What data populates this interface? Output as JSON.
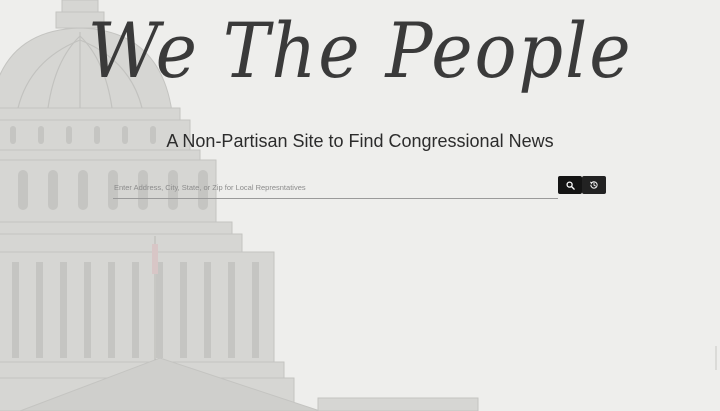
{
  "header": {
    "logo_text": "We The People",
    "tagline": "A Non-Partisan Site to Find Congressional News"
  },
  "search": {
    "value": "",
    "placeholder": "Enter Address, City, State, or Zip for Local Represntatives",
    "search_icon": "search-icon",
    "history_icon": "history-icon"
  },
  "background": {
    "image": "capitol-building-photo",
    "overlay_color": "#eeeeec"
  }
}
